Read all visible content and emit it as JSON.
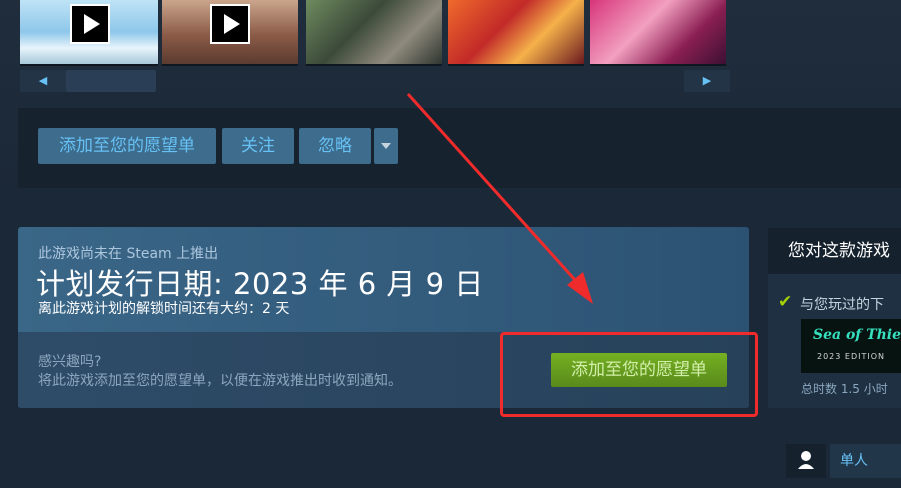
{
  "actions": {
    "wishlist": "添加至您的愿望单",
    "follow": "关注",
    "ignore": "忽略"
  },
  "release": {
    "not_released": "此游戏尚未在 Steam 上推出",
    "date": "计划发行日期: 2023 年 6 月 9 日",
    "unlock": "离此游戏计划的解锁时间还有大约：2 天",
    "interest_q": "感兴趣吗?",
    "interest_desc": "将此游戏添加至您的愿望单，以便在游戏推出时收到通知。",
    "wishlist_button": "添加至您的愿望单"
  },
  "right_panel": {
    "title": "您对这款游戏",
    "played_desc": "与您玩过的下",
    "game_name": "Sea of Thieves",
    "game_edition": "2023 EDITION",
    "hours": "总时数 1.5 小时"
  },
  "feature": {
    "label": "单人"
  },
  "colors": {
    "background": "#1b2838",
    "blue_button": "#3d6c8d",
    "green_button": "#75b022",
    "annotation_red": "#ef2b2b"
  }
}
